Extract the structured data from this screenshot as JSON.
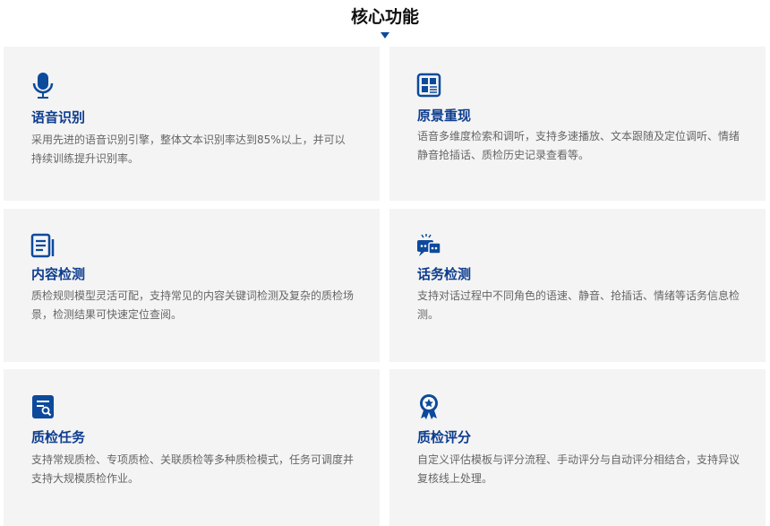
{
  "title": "核心功能",
  "accent": "#0d4a9c",
  "cards": [
    {
      "icon": "microphone-icon",
      "title": "语音识别",
      "desc": "采用先进的语音识别引擎，整体文本识别率达到85%以上，并可以持续训练提升识别率。"
    },
    {
      "icon": "layout-icon",
      "title": "原景重现",
      "desc": "语音多维度检索和调听，支持多速播放、文本跟随及定位调听、情绪静音抢插话、质检历史记录查看等。"
    },
    {
      "icon": "document-list-icon",
      "title": "内容检测",
      "desc": "质检规则模型灵活可配，支持常见的内容关键词检测及复杂的质检场景，检测结果可快速定位查阅。"
    },
    {
      "icon": "chat-icon",
      "title": "话务检测",
      "desc": "支持对话过程中不同角色的语速、静音、抢插话、情绪等话务信息检测。"
    },
    {
      "icon": "document-search-icon",
      "title": "质检任务",
      "desc": "支持常规质检、专项质检、关联质检等多种质检模式，任务可调度并支持大规模质检作业。"
    },
    {
      "icon": "award-icon",
      "title": "质检评分",
      "desc": "自定义评估模板与评分流程、手动评分与自动评分相结合，支持异议复核线上处理。"
    }
  ]
}
